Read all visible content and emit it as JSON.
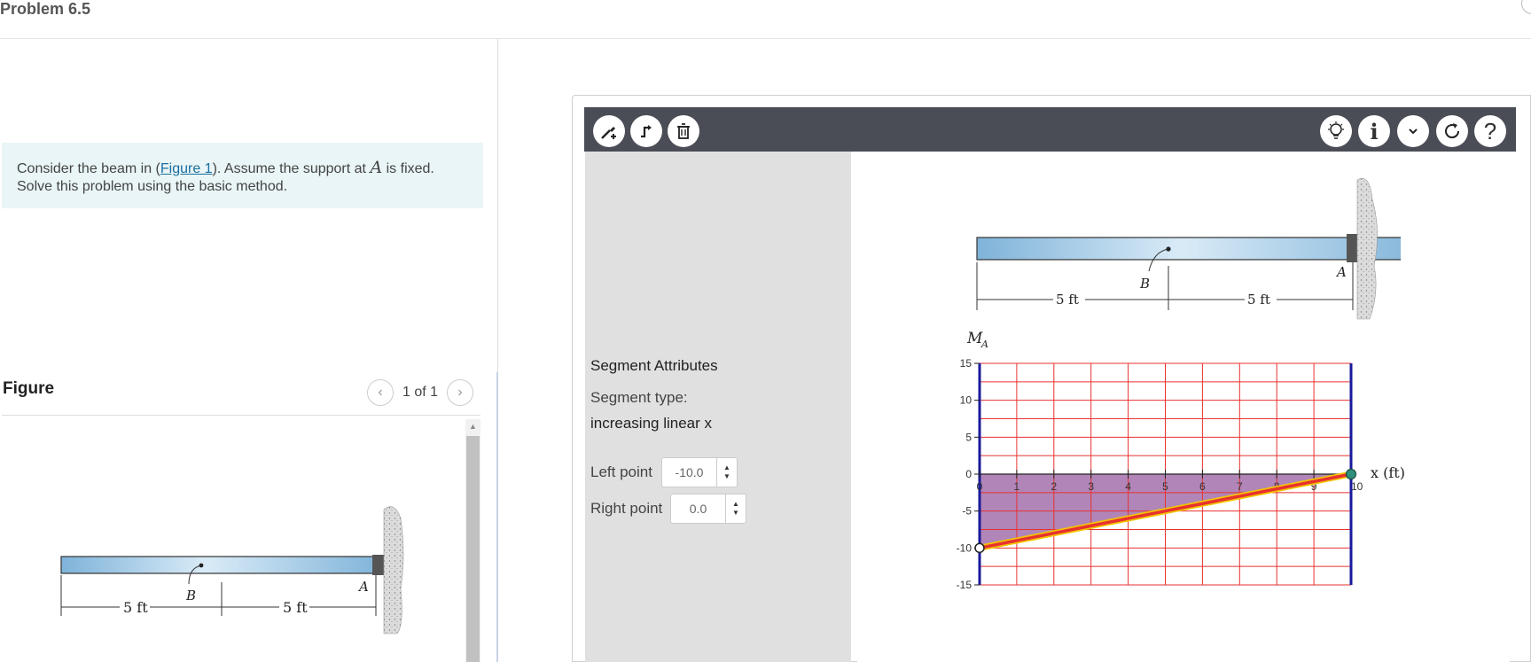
{
  "page": {
    "title": "Problem 6.5"
  },
  "problem": {
    "text_before": "Consider the beam in (",
    "figure_link": "Figure 1",
    "text_middle": "). Assume the support at ",
    "support_var": "A",
    "text_after": " is fixed.",
    "line2": "Solve this problem using the basic method."
  },
  "figure_panel": {
    "heading": "Figure",
    "pager": "1 of 1",
    "labels": {
      "left_span": "5 ft",
      "point_b": "B",
      "right_span": "5 ft",
      "point_a": "A"
    }
  },
  "toolbar": {
    "left_tools": [
      "draw-segment-icon",
      "step-segment-icon",
      "delete-icon"
    ],
    "right_tools": [
      "lightbulb-icon",
      "info-icon",
      "chevron-down-icon",
      "reset-icon",
      "help-icon"
    ],
    "help_glyph": "?",
    "info_glyph": "i"
  },
  "segment_panel": {
    "heading": "Segment Attributes",
    "type_label": "Segment type:",
    "type_value": "increasing linear x",
    "left_label": "Left point",
    "left_value": "-10.0",
    "right_label": "Right point",
    "right_value": "0.0"
  },
  "beam_diagram": {
    "left_span": "5 ft",
    "point_b": "B",
    "right_span": "5 ft",
    "point_a": "A"
  },
  "chart_data": {
    "type": "line",
    "ylabel": "M",
    "ylabel_sub": "A",
    "xlabel": "x (ft)",
    "xlim": [
      0,
      10
    ],
    "ylim": [
      -15,
      15
    ],
    "x_ticks": [
      "0",
      "1",
      "2",
      "3",
      "4",
      "5",
      "6",
      "7",
      "8",
      "9",
      "10"
    ],
    "y_ticks": [
      "15",
      "10",
      "5",
      "0",
      "-5",
      "-10",
      "-15"
    ],
    "y_tick_values": [
      15,
      10,
      5,
      0,
      -5,
      -10,
      -15
    ],
    "grid": true,
    "series": [
      {
        "x": [
          0,
          10
        ],
        "y": [
          -10,
          0
        ]
      }
    ],
    "colors": {
      "grid": "#e8312f",
      "axis": "#1a1a9c",
      "fill": "#a878b0",
      "line": "#e8312f",
      "line_edge": "#f2c500",
      "end_point": "#2f8f7a"
    }
  }
}
